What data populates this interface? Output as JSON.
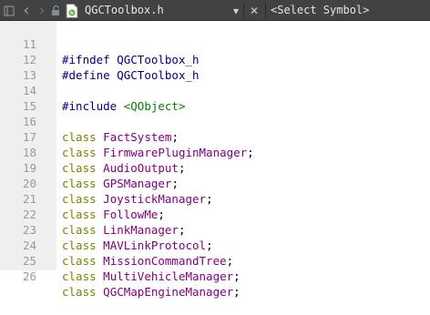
{
  "toolbar": {
    "file_name": "QGCToolbox.h",
    "symbol_selector": "<Select Symbol>",
    "back_glyph": "‹",
    "forward_glyph": "›",
    "dropdown_glyph": "▾",
    "close_glyph": "✕"
  },
  "editor": {
    "lines": [
      {
        "num": "11",
        "directive": "#ifndef",
        "name": " QGCToolbox_h"
      },
      {
        "num": "12",
        "directive": "#define",
        "name": " QGCToolbox_h"
      },
      {
        "num": "13"
      },
      {
        "num": "14",
        "directive": "#include",
        "include": " <QObject>"
      },
      {
        "num": "15"
      },
      {
        "num": "16",
        "kw": "class",
        "cls": "FactSystem",
        "end": ";"
      },
      {
        "num": "17",
        "kw": "class",
        "cls": "FirmwarePluginManager",
        "end": ";"
      },
      {
        "num": "18",
        "kw": "class",
        "cls": "AudioOutput",
        "end": ";"
      },
      {
        "num": "19",
        "kw": "class",
        "cls": "GPSManager",
        "end": ";"
      },
      {
        "num": "20",
        "kw": "class",
        "cls": "JoystickManager",
        "end": ";"
      },
      {
        "num": "21",
        "kw": "class",
        "cls": "FollowMe",
        "end": ";"
      },
      {
        "num": "22",
        "kw": "class",
        "cls": "LinkManager",
        "end": ";"
      },
      {
        "num": "23",
        "kw": "class",
        "cls": "MAVLinkProtocol",
        "end": ";"
      },
      {
        "num": "24",
        "kw": "class",
        "cls": "MissionCommandTree",
        "end": ";"
      },
      {
        "num": "25",
        "kw": "class",
        "cls": "MultiVehicleManager",
        "end": ";"
      },
      {
        "num": "26",
        "kw": "class",
        "cls": "QGCMapEngineManager",
        "end": ";"
      }
    ]
  },
  "colors": {
    "toolbar_bg": "#404244",
    "gutter_bg": "#efefef",
    "keyword": "#808000",
    "preprocessor": "#000080",
    "include_path": "#008000",
    "class_name": "#800080"
  }
}
